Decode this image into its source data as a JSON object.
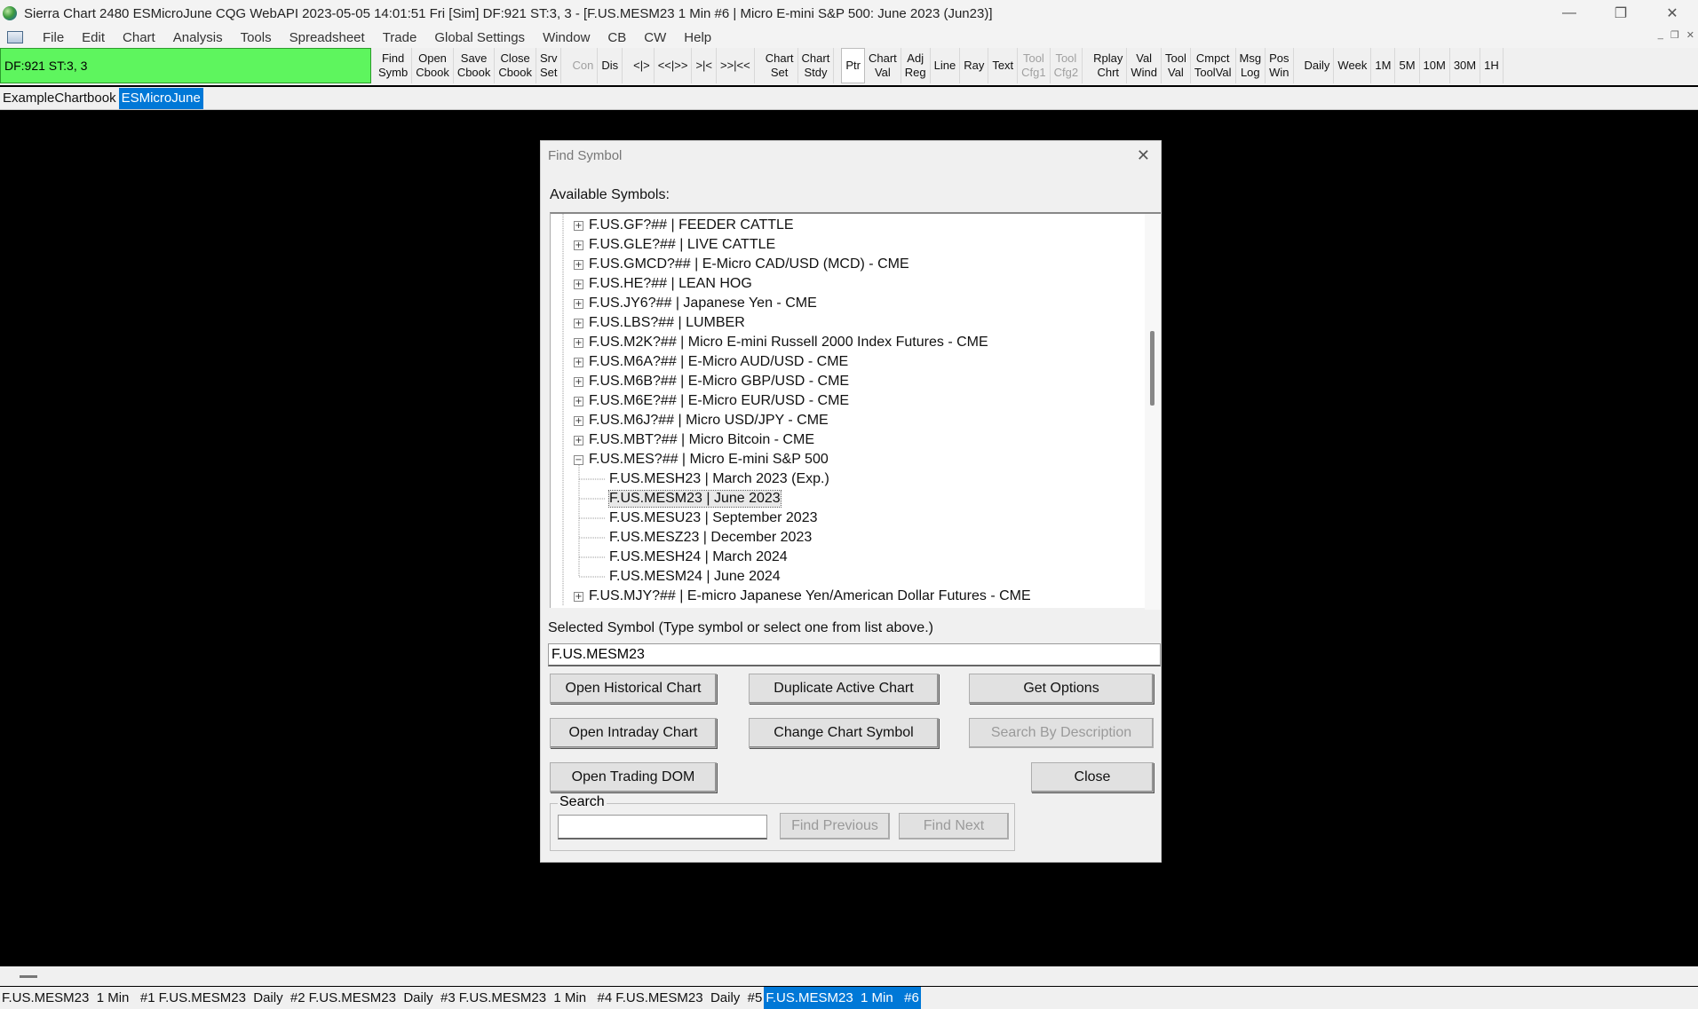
{
  "window": {
    "title": "Sierra Chart 2480 ESMicroJune  CQG WebAPI 2023-05-05  14:01:51 Fri [Sim]  DF:921  ST:3, 3 - [F.US.MESM23  1 Min   #6 | Micro E-mini S&P 500: June 2023 (Jun23)]",
    "minimize": "—",
    "restore": "❐",
    "close": "✕"
  },
  "menu": {
    "items": [
      "File",
      "Edit",
      "Chart",
      "Analysis",
      "Tools",
      "Spreadsheet",
      "Trade",
      "Global Settings",
      "Window",
      "CB",
      "CW",
      "Help"
    ],
    "mdi": [
      "_",
      "❐",
      "✕"
    ]
  },
  "toolbar": {
    "status": "DF:921  ST:3, 3",
    "status_color": "#5ef55e",
    "buttons": [
      {
        "l1": "Find",
        "l2": "Symb"
      },
      {
        "l1": "Open",
        "l2": "Cbook"
      },
      {
        "l1": "Save",
        "l2": "Cbook"
      },
      {
        "l1": "Close",
        "l2": "Cbook"
      },
      {
        "l1": "Srv",
        "l2": "Set"
      },
      {
        "l1": "Con",
        "l2": "",
        "disabled": true
      },
      {
        "l1": "Dis",
        "l2": ""
      },
      {
        "l1": "<|>",
        "l2": ""
      },
      {
        "l1": "<<|>>",
        "l2": ""
      },
      {
        "l1": ">|<",
        "l2": ""
      },
      {
        "l1": ">>|<<",
        "l2": ""
      },
      {
        "l1": "Chart",
        "l2": "Set"
      },
      {
        "l1": "Chart",
        "l2": "Stdy"
      },
      {
        "l1": "Ptr",
        "l2": "",
        "pressed": true
      },
      {
        "l1": "Chart",
        "l2": "Val"
      },
      {
        "l1": "Adj",
        "l2": "Reg"
      },
      {
        "l1": "Line",
        "l2": ""
      },
      {
        "l1": "Ray",
        "l2": ""
      },
      {
        "l1": "Text",
        "l2": ""
      },
      {
        "l1": "Tool",
        "l2": "Cfg1",
        "disabled": true
      },
      {
        "l1": "Tool",
        "l2": "Cfg2",
        "disabled": true
      },
      {
        "l1": "Rplay",
        "l2": "Chrt"
      },
      {
        "l1": "Val",
        "l2": "Wind"
      },
      {
        "l1": "Tool",
        "l2": "Val"
      },
      {
        "l1": "Cmpct",
        "l2": "ToolVal"
      },
      {
        "l1": "Msg",
        "l2": "Log"
      },
      {
        "l1": "Pos",
        "l2": "Win"
      },
      {
        "l1": "Daily",
        "l2": ""
      },
      {
        "l1": "Week",
        "l2": ""
      },
      {
        "l1": "1M",
        "l2": ""
      },
      {
        "l1": "5M",
        "l2": ""
      },
      {
        "l1": "10M",
        "l2": ""
      },
      {
        "l1": "30M",
        "l2": ""
      },
      {
        "l1": "1H",
        "l2": ""
      }
    ]
  },
  "chartbooks": {
    "tabs": [
      {
        "label": "ExampleChartbook",
        "active": false
      },
      {
        "label": "ESMicroJune",
        "active": true
      }
    ]
  },
  "dialog": {
    "title": "Find Symbol",
    "available_label": "Available Symbols:",
    "tree": [
      {
        "text": "F.US.GF?##  |  FEEDER CATTLE",
        "level": 0,
        "expander": "+"
      },
      {
        "text": "F.US.GLE?##  |  LIVE CATTLE",
        "level": 0,
        "expander": "+"
      },
      {
        "text": "F.US.GMCD?##  |  E-Micro CAD/USD (MCD) - CME",
        "level": 0,
        "expander": "+"
      },
      {
        "text": "F.US.HE?##  |  LEAN HOG",
        "level": 0,
        "expander": "+"
      },
      {
        "text": "F.US.JY6?##  |  Japanese Yen - CME",
        "level": 0,
        "expander": "+"
      },
      {
        "text": "F.US.LBS?##  |  LUMBER",
        "level": 0,
        "expander": "+"
      },
      {
        "text": "F.US.M2K?##  |  Micro E-mini Russell 2000 Index Futures - CME",
        "level": 0,
        "expander": "+"
      },
      {
        "text": "F.US.M6A?##  |  E-Micro AUD/USD - CME",
        "level": 0,
        "expander": "+"
      },
      {
        "text": "F.US.M6B?##  |  E-Micro GBP/USD - CME",
        "level": 0,
        "expander": "+"
      },
      {
        "text": "F.US.M6E?##  |  E-Micro EUR/USD - CME",
        "level": 0,
        "expander": "+"
      },
      {
        "text": "F.US.M6J?##  |  Micro USD/JPY - CME",
        "level": 0,
        "expander": "+"
      },
      {
        "text": "F.US.MBT?##  |  Micro Bitcoin - CME",
        "level": 0,
        "expander": "+"
      },
      {
        "text": "F.US.MES?##  |  Micro E-mini S&P 500",
        "level": 0,
        "expander": "−"
      },
      {
        "text": "F.US.MESH23  |  March 2023 (Exp.)",
        "level": 1
      },
      {
        "text": "F.US.MESM23  |  June 2023",
        "level": 1,
        "selected": true
      },
      {
        "text": "F.US.MESU23  |  September 2023",
        "level": 1
      },
      {
        "text": "F.US.MESZ23  |  December 2023",
        "level": 1
      },
      {
        "text": "F.US.MESH24  |  March 2024",
        "level": 1
      },
      {
        "text": "F.US.MESM24  |  June 2024",
        "level": 1
      },
      {
        "text": "F.US.MJY?##  |  E-micro Japanese Yen/American Dollar Futures - CME",
        "level": 0,
        "expander": "+"
      }
    ],
    "selected_label": "Selected Symbol (Type symbol or select one from list above.)",
    "selected_value": "F.US.MESM23",
    "buttons": {
      "open_historical": "Open Historical Chart",
      "duplicate_active": "Duplicate Active Chart",
      "get_options": "Get Options",
      "open_intraday": "Open Intraday Chart",
      "change_symbol": "Change Chart Symbol",
      "search_by_desc": "Search By Description",
      "open_dom": "Open Trading DOM",
      "close": "Close",
      "find_prev": "Find Previous",
      "find_next": "Find Next"
    },
    "search_label": "Search",
    "search_value": ""
  },
  "chart_tabs": [
    {
      "label": "F.US.MESM23  1 Min   #1",
      "active": false
    },
    {
      "label": "F.US.MESM23  Daily  #2",
      "active": false
    },
    {
      "label": "F.US.MESM23  Daily  #3",
      "active": false
    },
    {
      "label": "F.US.MESM23  1 Min   #4",
      "active": false
    },
    {
      "label": "F.US.MESM23  Daily  #5",
      "active": false
    },
    {
      "label": "F.US.MESM23  1 Min   #6",
      "active": true
    }
  ]
}
